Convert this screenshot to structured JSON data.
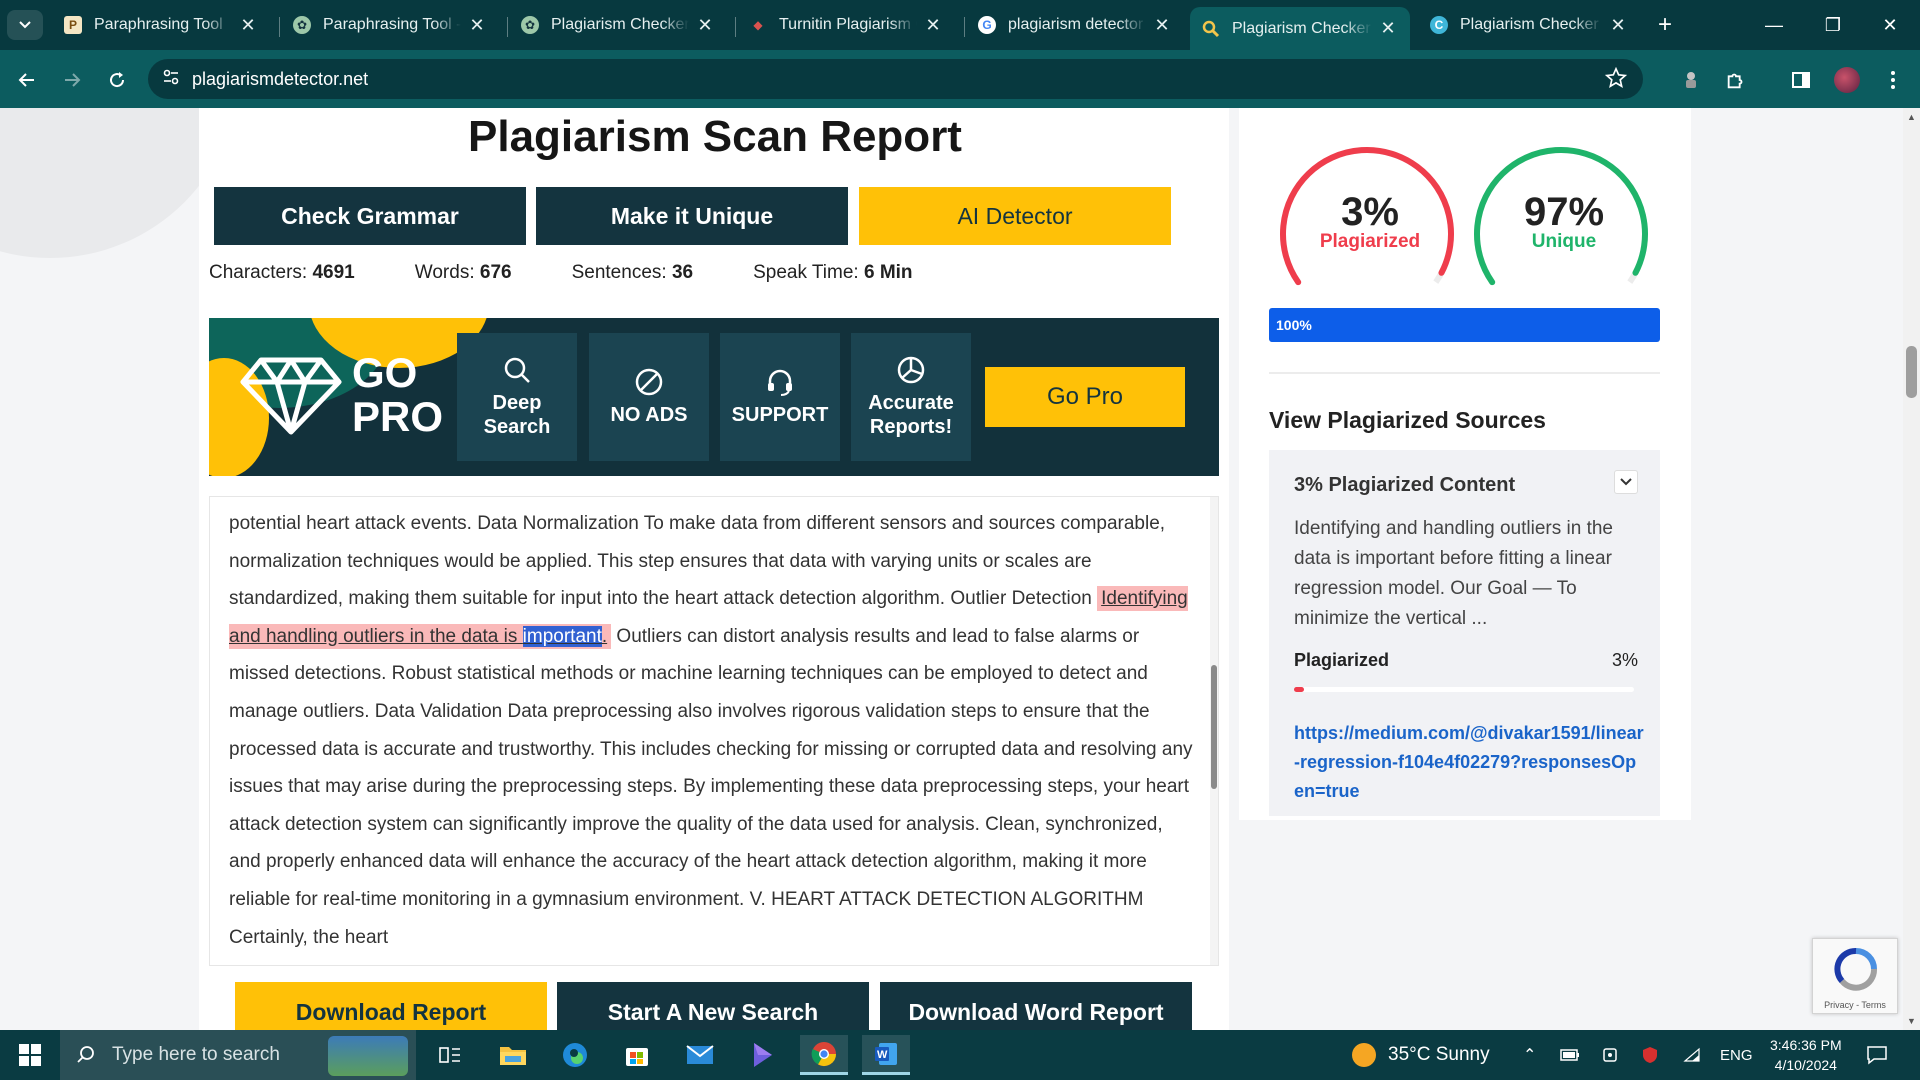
{
  "browser": {
    "tabs": [
      {
        "title": "Paraphrasing Tool",
        "favicon": "paraphrasing-tool-favicon",
        "active": false
      },
      {
        "title": "Paraphrasing Tool - C",
        "favicon": "chatgpt-favicon",
        "active": false
      },
      {
        "title": "Plagiarism Checker -",
        "favicon": "chatgpt-favicon",
        "active": false
      },
      {
        "title": "Turnitin Plagiarism C",
        "favicon": "turnitin-favicon",
        "active": false
      },
      {
        "title": "plagiarism detector r",
        "favicon": "google-favicon",
        "active": false
      },
      {
        "title": "Plagiarism Checker F",
        "favicon": "search-favicon",
        "active": true
      },
      {
        "title": "Plagiarism Checker |",
        "favicon": "checker-favicon",
        "active": false
      }
    ],
    "url": "plagiarismdetector.net"
  },
  "page": {
    "title": "Plagiarism Scan Report",
    "actions": {
      "grammar": "Check Grammar",
      "unique": "Make it Unique",
      "ai": "AI Detector"
    },
    "stats": {
      "characters_label": "Characters:",
      "characters": "4691",
      "words_label": "Words:",
      "words": "676",
      "sentences_label": "Sentences:",
      "sentences": "36",
      "speak_label": "Speak Time:",
      "speak": "6 Min"
    },
    "gopro": {
      "go": "GO",
      "pro": "PRO",
      "features": [
        "Deep Search",
        "NO ADS",
        "SUPPORT",
        "Accurate Reports!"
      ],
      "button": "Go Pro"
    },
    "text": {
      "before": "potential heart attack events. Data Normalization To make data from different sensors and sources comparable, normalization techniques would be applied. This step ensures that data with varying units or scales are standardized, making them suitable for input into the heart attack detection algorithm. Outlier Detection ",
      "highlight_main": "Identifying and handling outliers in the data is ",
      "highlight_selected": "important",
      "highlight_end": ".",
      "after": " Outliers can distort analysis results and lead to false alarms or missed detections. Robust statistical methods or machine learning techniques can be employed to detect and manage outliers. Data Validation Data preprocessing also involves rigorous validation steps to ensure that the processed data is accurate and trustworthy. This includes checking for missing or corrupted data and resolving any issues that may arise during the preprocessing steps. By implementing these data preprocessing steps, your heart attack detection system can significantly improve the quality of the data used for analysis. Clean, synchronized, and properly enhanced data will enhance the accuracy of the heart attack detection algorithm, making it more reliable for real-time monitoring in a gymnasium environment. V. HEART ATTACK DETECTION ALGORITHM Certainly, the heart"
    },
    "bottom_buttons": {
      "download": "Download Report",
      "new_search": "Start A New Search",
      "word": "Download Word Report"
    }
  },
  "sidebar": {
    "plagiarized": {
      "value": "3%",
      "label": "Plagiarized",
      "fraction": 0.03,
      "color": "#ef3d4c"
    },
    "unique": {
      "value": "97%",
      "label": "Unique",
      "fraction": 0.97,
      "color": "#1fb46a"
    },
    "progress": "100%",
    "sources_title": "View Plagiarized Sources",
    "card": {
      "heading": "3% Plagiarized Content",
      "excerpt": "Identifying and handling outliers in the data is important before fitting a linear regression model. Our Goal — To minimize the vertical ...",
      "plag_label": "Plagiarized",
      "plag_value": "3%",
      "link": "https://medium.com/@divakar1591/linear-regression-f104e4f02279?responsesOpen=true"
    },
    "recaptcha": "Privacy - Terms"
  },
  "taskbar": {
    "search_placeholder": "Type here to search",
    "weather": "35°C  Sunny",
    "lang": "ENG",
    "time": "3:46:36 PM",
    "date": "4/10/2024"
  }
}
